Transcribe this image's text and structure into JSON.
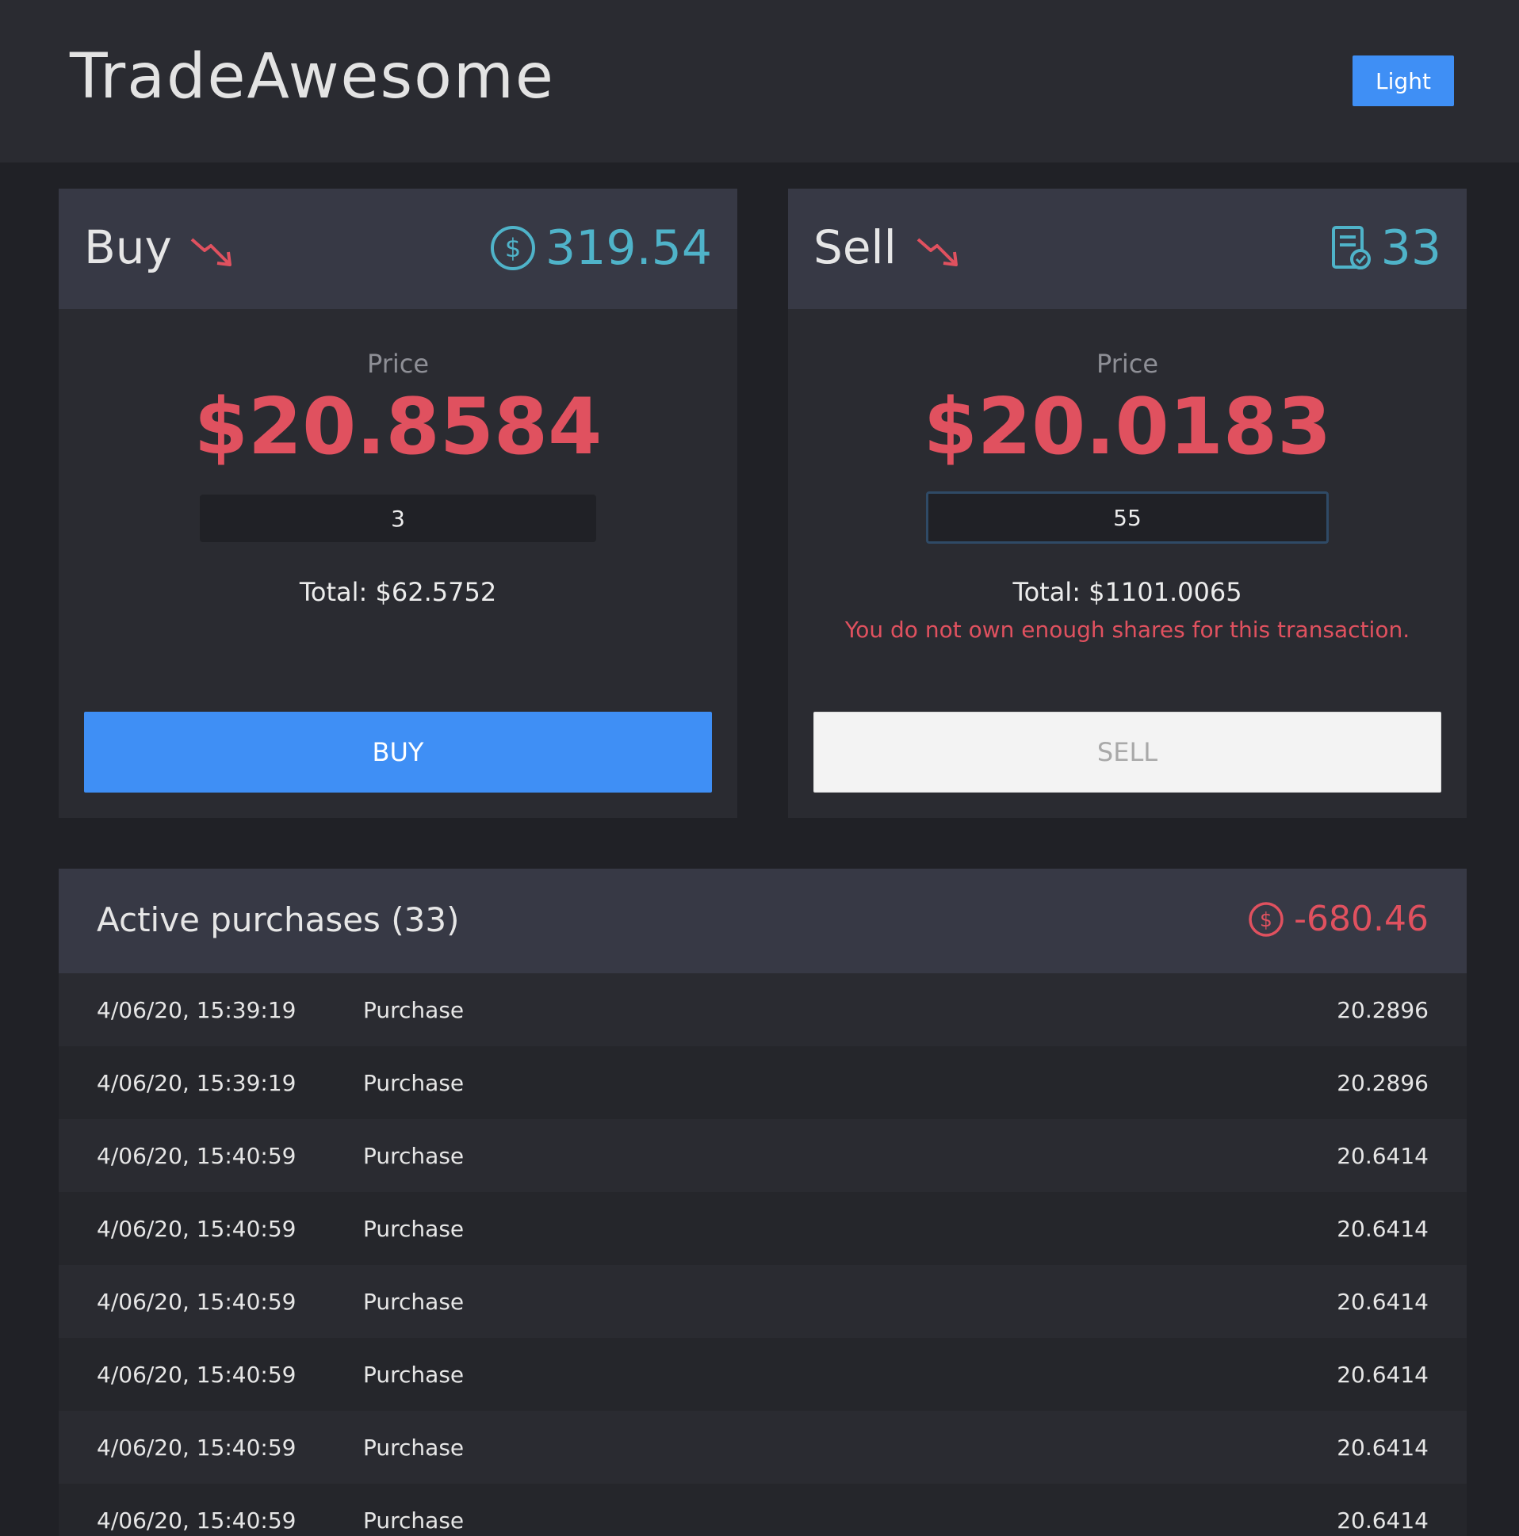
{
  "header": {
    "brand": "TradeAwesome",
    "theme_button": "Light"
  },
  "buy": {
    "title": "Buy",
    "trend_icon": "trending-down-icon",
    "balance_icon": "dollar-circle-icon",
    "balance": "319.54",
    "price_label": "Price",
    "price": "$20.8584",
    "quantity": "3",
    "total": "Total: $62.5752",
    "button": "BUY"
  },
  "sell": {
    "title": "Sell",
    "trend_icon": "trending-down-icon",
    "shares_icon": "document-check-icon",
    "shares": "33",
    "price_label": "Price",
    "price": "$20.0183",
    "quantity": "55",
    "total": "Total: $1101.0065",
    "error": "You do not own enough shares for this transaction.",
    "button": "SELL"
  },
  "purchases": {
    "title": "Active purchases (33)",
    "total_icon": "dollar-circle-icon",
    "total": "-680.46",
    "rows": [
      {
        "date": "4/06/20, 15:39:19",
        "type": "Purchase",
        "price": "20.2896"
      },
      {
        "date": "4/06/20, 15:39:19",
        "type": "Purchase",
        "price": "20.2896"
      },
      {
        "date": "4/06/20, 15:40:59",
        "type": "Purchase",
        "price": "20.6414"
      },
      {
        "date": "4/06/20, 15:40:59",
        "type": "Purchase",
        "price": "20.6414"
      },
      {
        "date": "4/06/20, 15:40:59",
        "type": "Purchase",
        "price": "20.6414"
      },
      {
        "date": "4/06/20, 15:40:59",
        "type": "Purchase",
        "price": "20.6414"
      },
      {
        "date": "4/06/20, 15:40:59",
        "type": "Purchase",
        "price": "20.6414"
      },
      {
        "date": "4/06/20, 15:40:59",
        "type": "Purchase",
        "price": "20.6414"
      }
    ]
  },
  "colors": {
    "accent": "#3f8ff5",
    "negative": "#e0515f",
    "info": "#4fb3c9",
    "background": "#202126",
    "panel": "#2a2b31",
    "panel_header": "#373945"
  }
}
